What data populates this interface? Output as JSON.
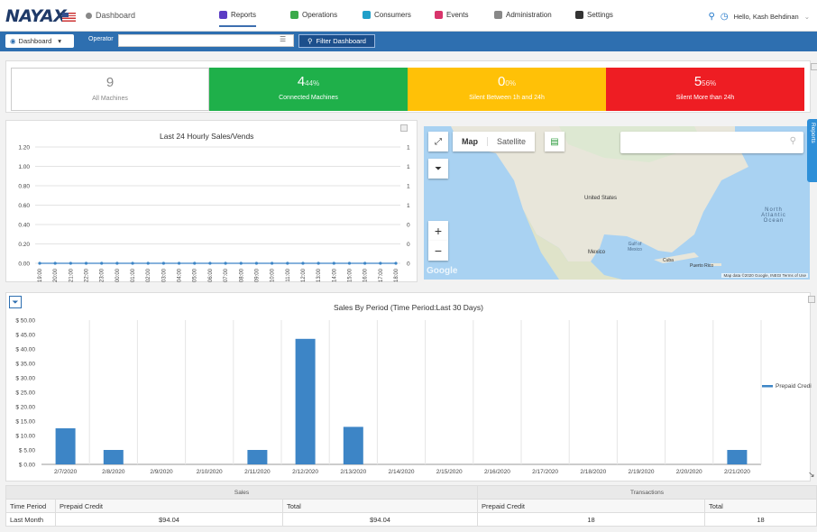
{
  "brand": "NAYAX",
  "breadcrumb": "Dashboard",
  "nav": [
    {
      "label": "Reports",
      "color": "#5b3cc4"
    },
    {
      "label": "Operations",
      "color": "#3aaa4a"
    },
    {
      "label": "Consumers",
      "color": "#1f9fc9"
    },
    {
      "label": "Events",
      "color": "#d8346b"
    },
    {
      "label": "Administration",
      "color": "#888888"
    },
    {
      "label": "Settings",
      "color": "#333333"
    }
  ],
  "user": {
    "greeting": "Hello, Kash Behdinan"
  },
  "toolbar": {
    "dashboard_label": "Dashboard",
    "operator_label": "Operator",
    "operator_value": "",
    "filter_label": "Filter Dashboard"
  },
  "status": [
    {
      "value": "9",
      "pct": "",
      "label": "All Machines",
      "color": "#ffffff",
      "text": "#888888"
    },
    {
      "value": "4",
      "pct": "44%",
      "label": "Connected Machines",
      "color": "#1fb04a",
      "text": "#ffffff"
    },
    {
      "value": "0",
      "pct": "0%",
      "label": "Silent Between 1h and 24h",
      "color": "#ffc107",
      "text": "#ffffff"
    },
    {
      "value": "5",
      "pct": "56%",
      "label": "Silent More than 24h",
      "color": "#ee1d23",
      "text": "#ffffff"
    }
  ],
  "hourly": {
    "title": "Last 24 Hourly Sales/Vends",
    "y_ticks": [
      "1.20",
      "1.00",
      "0.80",
      "0.60",
      "0.40",
      "0.20",
      "0.00"
    ],
    "y2_ticks": [
      "1",
      "1",
      "1",
      "1",
      "0",
      "0",
      "0"
    ],
    "hours": [
      "19:00",
      "20:00",
      "21:00",
      "22:00",
      "23:00",
      "00:00",
      "01:00",
      "02:00",
      "03:00",
      "04:00",
      "05:00",
      "06:00",
      "07:00",
      "08:00",
      "09:00",
      "10:00",
      "11:00",
      "12:00",
      "13:00",
      "14:00",
      "15:00",
      "16:00",
      "17:00",
      "18:00"
    ]
  },
  "map": {
    "map_tab": "Map",
    "satellite_tab": "Satellite",
    "labels": {
      "us": "United States",
      "mexico": "Mexico",
      "gulf": "Gulf of Mexico",
      "ocean": "North Atlantic Ocean",
      "cuba": "Cuba",
      "pr": "Puerto Rico"
    },
    "attribution": "Map data ©2020 Google, INEGI    Terms of Use",
    "google": "Google"
  },
  "side_tab": "Reports",
  "chart_data": {
    "type": "bar",
    "title": "Sales By Period (Time Period:Last 30 Days)",
    "categories": [
      "2/7/2020",
      "2/8/2020",
      "2/9/2020",
      "2/10/2020",
      "2/11/2020",
      "2/12/2020",
      "2/13/2020",
      "2/14/2020",
      "2/15/2020",
      "2/16/2020",
      "2/17/2020",
      "2/18/2020",
      "2/19/2020",
      "2/20/2020",
      "2/21/2020"
    ],
    "series": [
      {
        "name": "Prepaid Credit",
        "values": [
          12.5,
          5.0,
          0,
          0,
          5.0,
          43.5,
          13.0,
          0,
          0,
          0,
          0,
          0,
          0,
          0,
          5.0
        ]
      }
    ],
    "y_ticks": [
      "$ 0.00",
      "$ 5.00",
      "$ 10.00",
      "$ 15.00",
      "$ 20.00",
      "$ 25.00",
      "$ 30.00",
      "$ 35.00",
      "$ 40.00",
      "$ 45.00",
      "$ 50.00"
    ],
    "ylim": [
      0,
      50
    ],
    "legend": "right",
    "color": "#3d85c6"
  },
  "table": {
    "group_sales": "Sales",
    "group_transactions": "Transactions",
    "headers": [
      "Time Period",
      "Prepaid Credit",
      "Total",
      "Prepaid Credit",
      "Total"
    ],
    "rows": [
      [
        "Last Month",
        "$94.04",
        "$94.04",
        "18",
        "18"
      ]
    ]
  }
}
